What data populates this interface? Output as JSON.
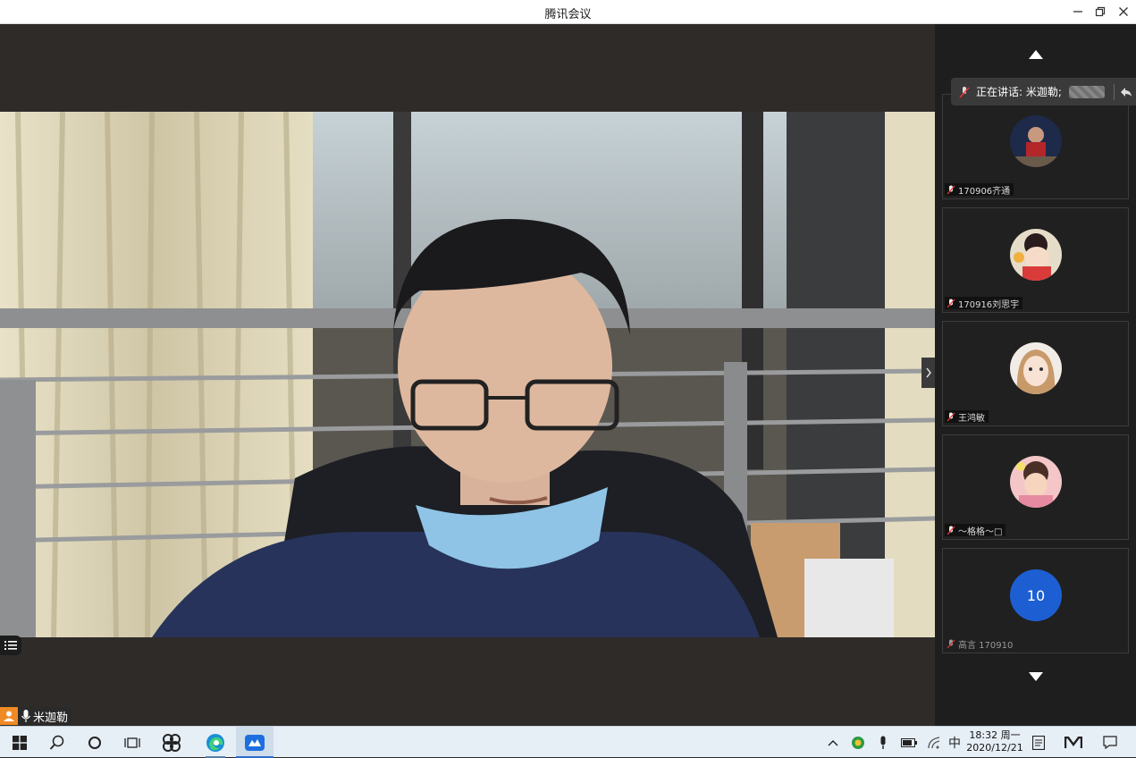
{
  "window": {
    "title": "腾讯会议"
  },
  "speaking": {
    "label": "正在讲话: 米迦勒;"
  },
  "main_video": {
    "name": "米迦勒"
  },
  "participants": [
    {
      "name": "170906齐通"
    },
    {
      "name": "170916刘思宇"
    },
    {
      "name": "王鸿敏"
    },
    {
      "name": "～格格～□"
    },
    {
      "name": "高言 170910",
      "avatar_text": "10"
    }
  ],
  "taskbar": {
    "ime": "中",
    "time": "18:32 周一",
    "date": "2020/12/21"
  },
  "colors": {
    "accent": "#1d5fd3",
    "nameplate_avatar": "#f08a24"
  }
}
